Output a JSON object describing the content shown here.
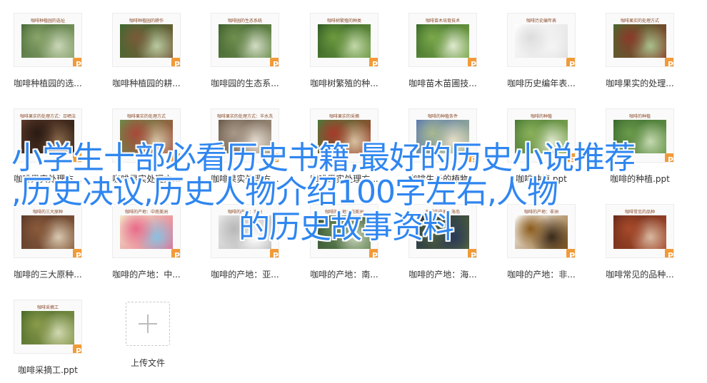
{
  "files": [
    {
      "name": "咖啡种植园的选...",
      "slide_title": "咖啡种植园的选址",
      "palette": [
        "#4a6b3a",
        "#8aa46a",
        "#c9d6b8"
      ]
    },
    {
      "name": "咖啡种植园的耕...",
      "slide_title": "咖啡种植园的耕作",
      "palette": [
        "#3c6a2e",
        "#7a5a3a",
        "#b8c9a0"
      ]
    },
    {
      "name": "咖啡园的生态系...",
      "slide_title": "咖啡园的生态系统",
      "palette": [
        "#3f5f2f",
        "#6f8f4f",
        "#d2dcc4"
      ]
    },
    {
      "name": "咖啡树繁殖的种...",
      "slide_title": "咖啡树繁殖的种类",
      "palette": [
        "#2f5a24",
        "#6d9a3e",
        "#c2d8a8"
      ]
    },
    {
      "name": "咖啡苗木苗圃技...",
      "slide_title": "咖啡苗木培育技术",
      "palette": [
        "#3a6a28",
        "#7ba84a",
        "#dfe9cf"
      ]
    },
    {
      "name": "咖啡历史编年表...",
      "slide_title": "咖啡历史编年表",
      "palette": [
        "#ffffff",
        "#dddddd",
        "#f4f4f4"
      ]
    },
    {
      "name": "咖啡果实的处理...",
      "slide_title": "咖啡果实的处理方式",
      "palette": [
        "#4a6a30",
        "#8b3a2a",
        "#a8c08a"
      ]
    },
    {
      "name": "咖啡果实处理方...",
      "slide_title": "咖啡果实的处理方式：日晒法",
      "palette": [
        "#5a3a2a",
        "#2a1a12",
        "#8a6a4a"
      ]
    },
    {
      "name": "咖啡果实处理方...",
      "slide_title": "咖啡果实的处理方式",
      "palette": [
        "#6a8a4a",
        "#a84a3a",
        "#d4c4a4"
      ]
    },
    {
      "name": "咖啡果实处理方...",
      "slide_title": "咖啡果实的处理方式：半水洗",
      "palette": [
        "#6a5a4a",
        "#a89888",
        "#e4dcd0"
      ]
    },
    {
      "name": "咖啡果实处理方...",
      "slide_title": "咖啡果实的采摘",
      "palette": [
        "#4a7a3a",
        "#a83a2a",
        "#d8c0a0"
      ]
    },
    {
      "name": "咖啡生长的植物...",
      "slide_title": "咖啡的种植条件",
      "palette": [
        "#5a7ab0",
        "#a8b890",
        "#e8e0c8"
      ]
    },
    {
      "name": "咖啡种植.ppt",
      "slide_title": "咖啡的种植",
      "palette": [
        "#4a7a34",
        "#8ab05a",
        "#e0e8d0"
      ]
    },
    {
      "name": "咖啡的种植.ppt",
      "slide_title": "咖啡的种植",
      "palette": [
        "#3a6a2e",
        "#6a9a4a",
        "#c4d8b0"
      ]
    },
    {
      "name": "咖啡的三大原种...",
      "slide_title": "咖啡的三大原种",
      "palette": [
        "#5a3a2a",
        "#8a5a3a",
        "#d8c8b0"
      ]
    },
    {
      "name": "咖啡的产地：中...",
      "slide_title": "咖啡的产地：中南美洲",
      "palette": [
        "#f2e8c8",
        "#e86a8a",
        "#8ac0e0"
      ]
    },
    {
      "name": "咖啡的产地：亚...",
      "slide_title": "咖啡的产地：亚洲",
      "palette": [
        "#e8e8e8",
        "#b8b8b8",
        "#ffffff"
      ]
    },
    {
      "name": "咖啡的产地：南...",
      "slide_title": "咖啡的产地：南美洲",
      "palette": [
        "#2a4a2a",
        "#6a8a5a",
        "#c8d4b8"
      ]
    },
    {
      "name": "咖啡的产地：海...",
      "slide_title": "咖啡的产地：海岛",
      "palette": [
        "#1a2a4a",
        "#5a6a3a",
        "#2a3a5a"
      ]
    },
    {
      "name": "咖啡的产地：非...",
      "slide_title": "咖啡的产地：非洲",
      "palette": [
        "#ffffff",
        "#8a5a1a",
        "#3a2a1a"
      ]
    },
    {
      "name": "咖啡常见的品种...",
      "slide_title": "咖啡常见的品种",
      "palette": [
        "#6a2a1a",
        "#a84a2a",
        "#d8b8a0"
      ]
    },
    {
      "name": "咖啡采摘工.ppt",
      "slide_title": "咖啡采摘工",
      "palette": [
        "#4a6a2a",
        "#8a9a4a",
        "#d0d8b0"
      ]
    }
  ],
  "badge_letter": "P",
  "upload": {
    "label": "上传文件"
  },
  "overlay": {
    "line1": "小学生十部必看历史书籍,最好的历史小说推荐",
    "line2": ",历史决议,历史人物介绍100字左右,人物",
    "line3": "的历史故事资料"
  }
}
